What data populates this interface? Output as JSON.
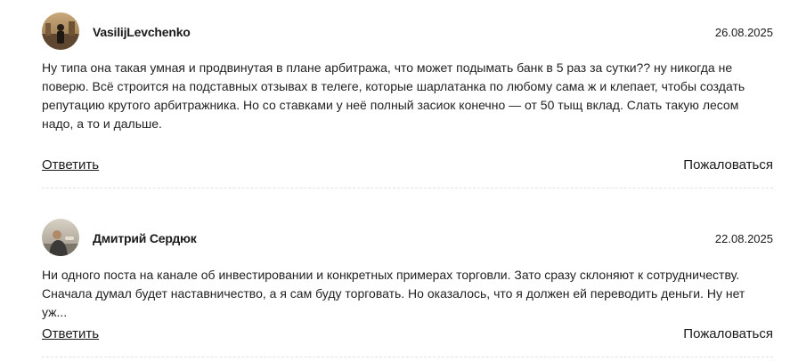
{
  "comments": [
    {
      "author": "VasilijLevchenko",
      "date": "26.08.2025",
      "text": "Ну типа она такая умная и продвинутая в плане арбитража, что может подымать банк в 5 раз за сутки?? ну никогда не поверю. Всё строится на подставных отзывах в телеге, которые шарлатанка по любому сама ж и клепает, чтобы создать репутацию крутого арбитражника. Но со ставками у неё полный засиок конечно — от 50 тыщ вклад. Слать такую лесом надо, а то и дальше.",
      "reply_label": "Ответить",
      "report_label": "Пожаловаться",
      "avatar_icon": "user-photo-icon"
    },
    {
      "author": "Дмитрий Сердюк",
      "date": "22.08.2025",
      "text": "Ни одного поста на канале об инвестировании и конкретных примерах торговли. Зато сразу склоняют к сотрудничеству. Сначала думал будет наставничество, а я сам буду торговать. Но оказалось, что я должен ей переводить деньги. Ну нет уж...",
      "reply_label": "Ответить",
      "report_label": "Пожаловаться",
      "avatar_icon": "user-photo-icon"
    }
  ],
  "colors": {
    "text": "#222222",
    "divider": "#e2e2e2"
  }
}
